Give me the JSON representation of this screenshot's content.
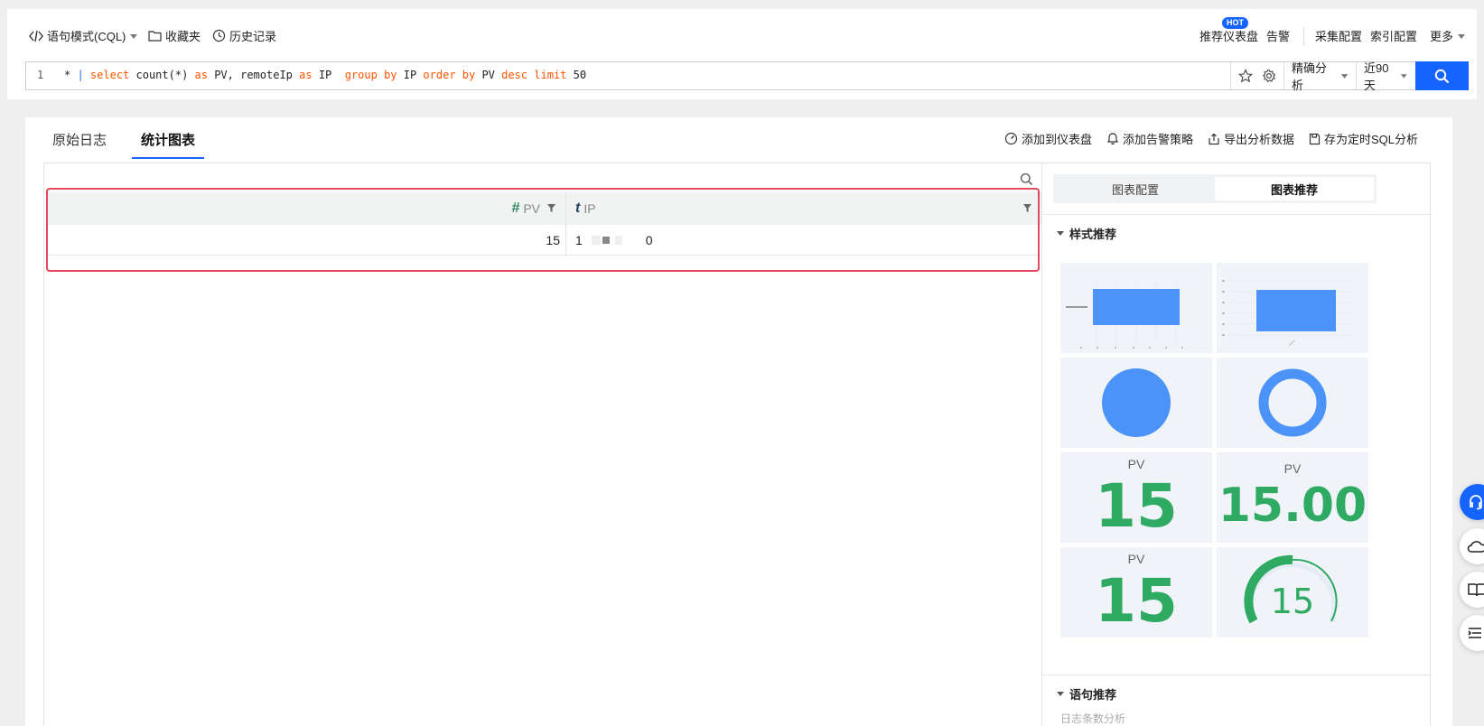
{
  "toolbar": {
    "mode": "语句模式(CQL)",
    "favorites": "收藏夹",
    "history": "历史记录",
    "recommended_dashboards": "推荐仪表盘",
    "hot_badge": "HOT",
    "alarm": "告警",
    "collection_config": "采集配置",
    "index_config": "索引配置",
    "more": "更多"
  },
  "query": {
    "line_number": "1",
    "tokens": [
      {
        "t": "* ",
        "k": "plain"
      },
      {
        "t": "|",
        "k": "pipe"
      },
      {
        "t": " ",
        "k": "plain"
      },
      {
        "t": "select",
        "k": "kw"
      },
      {
        "t": " count(*) ",
        "k": "plain"
      },
      {
        "t": "as",
        "k": "kw"
      },
      {
        "t": " PV, remoteIp ",
        "k": "plain"
      },
      {
        "t": "as",
        "k": "kw"
      },
      {
        "t": " IP  ",
        "k": "plain"
      },
      {
        "t": "group by",
        "k": "kw"
      },
      {
        "t": " IP ",
        "k": "plain"
      },
      {
        "t": "order by",
        "k": "kw"
      },
      {
        "t": " PV ",
        "k": "plain"
      },
      {
        "t": "desc",
        "k": "kw"
      },
      {
        "t": " ",
        "k": "plain"
      },
      {
        "t": "limit",
        "k": "kw"
      },
      {
        "t": " 50",
        "k": "plain"
      }
    ],
    "analysis_mode": "精确分析",
    "time_range": "近90天"
  },
  "tabs": [
    {
      "label": "原始日志",
      "active": false
    },
    {
      "label": "统计图表",
      "active": true
    }
  ],
  "actions": {
    "add_dashboard": "添加到仪表盘",
    "add_alarm": "添加告警策略",
    "export": "导出分析数据",
    "save_sql": "存为定时SQL分析"
  },
  "table": {
    "columns": [
      {
        "type_glyph": "#",
        "name": "PV"
      },
      {
        "type_glyph": "t",
        "name": "IP"
      }
    ],
    "rows": [
      {
        "pv": "15",
        "ip_start": "1",
        "ip_end": "0"
      }
    ]
  },
  "side": {
    "tab_config": "图表配置",
    "tab_recommend": "图表推荐",
    "style_section": "样式推荐",
    "statement_section": "语句推荐",
    "statement_hint": "日志条数分析",
    "thumb_label": "PV",
    "thumb_value_int": "15",
    "thumb_value_dec": "15.00",
    "gauge_value": "15"
  },
  "colors": {
    "accent": "#1664ff",
    "highlight": "#e34a5c",
    "keyword": "#ff5500",
    "metric_green": "#2eaa62",
    "chart_blue": "#4b93f8"
  }
}
